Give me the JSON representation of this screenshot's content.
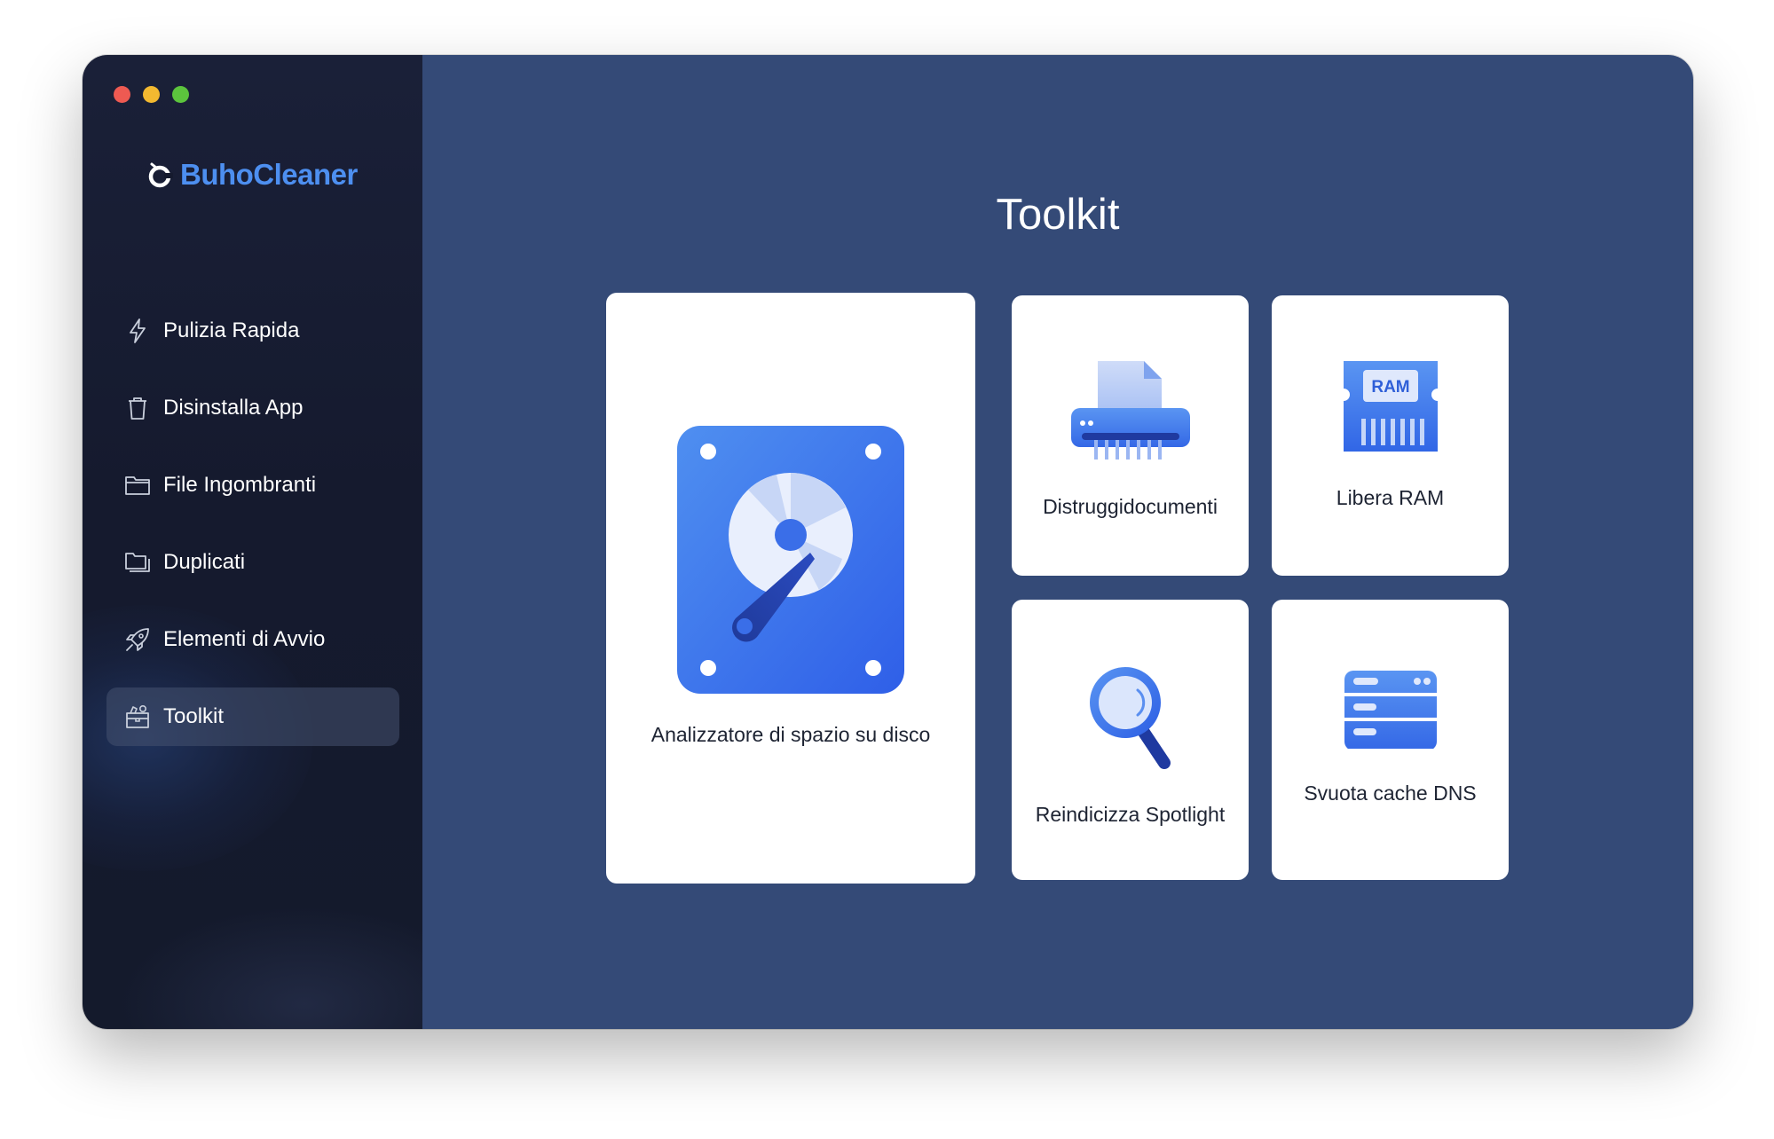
{
  "app": {
    "name": "BuhoCleaner",
    "brand_color": "#4d8ff0"
  },
  "window_controls": [
    "close",
    "minimize",
    "zoom"
  ],
  "sidebar": {
    "items": [
      {
        "label": "Pulizia Rapida",
        "icon": "lightning-icon",
        "active": false
      },
      {
        "label": "Disinstalla App",
        "icon": "trash-icon",
        "active": false
      },
      {
        "label": "File Ingombranti",
        "icon": "folder-icon",
        "active": false
      },
      {
        "label": "Duplicati",
        "icon": "duplicate-folder-icon",
        "active": false
      },
      {
        "label": "Elementi di Avvio",
        "icon": "rocket-icon",
        "active": false
      },
      {
        "label": "Toolkit",
        "icon": "toolbox-icon",
        "active": true
      }
    ]
  },
  "main": {
    "title": "Toolkit",
    "background": "#344a77",
    "tools": [
      {
        "label": "Analizzatore di spazio su disco",
        "icon": "disk-analyzer-icon"
      },
      {
        "label": "Distruggidocumenti",
        "icon": "shredder-icon"
      },
      {
        "label": "Libera RAM",
        "icon": "ram-icon",
        "icon_text": "RAM"
      },
      {
        "label": "Reindicizza Spotlight",
        "icon": "magnifier-icon"
      },
      {
        "label": "Svuota cache DNS",
        "icon": "server-icon"
      }
    ]
  }
}
